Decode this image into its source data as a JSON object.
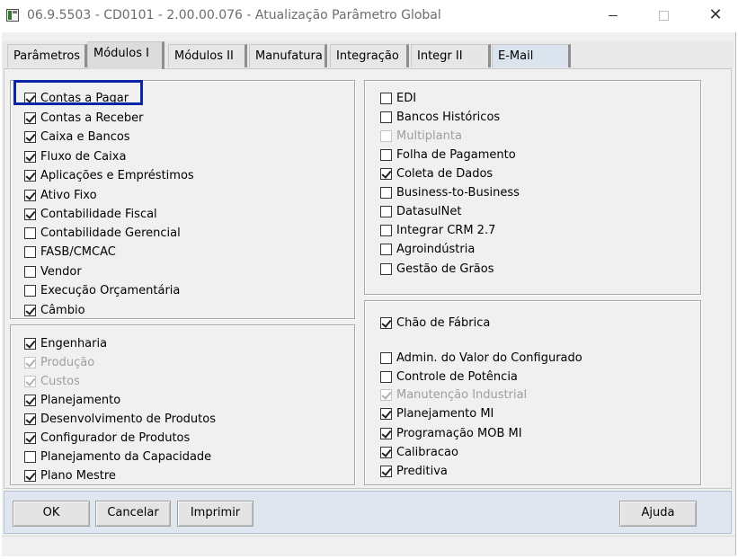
{
  "window": {
    "title": "06.9.5503 - CD0101 - 2.00.00.076 - Atualização Parâmetro Global",
    "close_glyph": "✕"
  },
  "tabs": [
    {
      "label": "Parâmetros"
    },
    {
      "label": "Módulos I",
      "active": true
    },
    {
      "label": "Módulos II"
    },
    {
      "label": "Manufatura"
    },
    {
      "label": "Integração"
    },
    {
      "label": "Integr II"
    },
    {
      "label": "E-Mail"
    }
  ],
  "groups": {
    "financeiro": [
      {
        "label": "Contas a Pagar",
        "checked": true,
        "enabled": true,
        "focused": true
      },
      {
        "label": "Contas a Receber",
        "checked": true,
        "enabled": true
      },
      {
        "label": "Caixa e Bancos",
        "checked": true,
        "enabled": true
      },
      {
        "label": "Fluxo de Caixa",
        "checked": true,
        "enabled": true
      },
      {
        "label": "Aplicações e Empréstimos",
        "checked": true,
        "enabled": true
      },
      {
        "label": "Ativo Fixo",
        "checked": true,
        "enabled": true
      },
      {
        "label": "Contabilidade Fiscal",
        "checked": true,
        "enabled": true
      },
      {
        "label": "Contabilidade Gerencial",
        "checked": false,
        "enabled": true
      },
      {
        "label": "FASB/CMCAC",
        "checked": false,
        "enabled": true
      },
      {
        "label": "Vendor",
        "checked": false,
        "enabled": true
      },
      {
        "label": "Execução Orçamentária",
        "checked": false,
        "enabled": true
      },
      {
        "label": "Câmbio",
        "checked": true,
        "enabled": true
      }
    ],
    "integracao": [
      {
        "label": "EDI",
        "checked": false,
        "enabled": true
      },
      {
        "label": "Bancos Históricos",
        "checked": false,
        "enabled": true
      },
      {
        "label": "Multiplanta",
        "checked": false,
        "enabled": false
      },
      {
        "label": "Folha de Pagamento",
        "checked": false,
        "enabled": true
      },
      {
        "label": "Coleta de Dados",
        "checked": true,
        "enabled": true
      },
      {
        "label": "Business-to-Business",
        "checked": false,
        "enabled": true
      },
      {
        "label": "DatasulNet",
        "checked": false,
        "enabled": true
      },
      {
        "label": "Integrar CRM 2.7",
        "checked": false,
        "enabled": true
      },
      {
        "label": "Agroindústria",
        "checked": false,
        "enabled": true
      },
      {
        "label": "Gestão de Grãos",
        "checked": false,
        "enabled": true
      }
    ],
    "engenharia": [
      {
        "label": "Engenharia",
        "checked": true,
        "enabled": true
      },
      {
        "label": "Produção",
        "checked": true,
        "enabled": false
      },
      {
        "label": "Custos",
        "checked": true,
        "enabled": false
      },
      {
        "label": "Planejamento",
        "checked": true,
        "enabled": true
      },
      {
        "label": "Desenvolvimento de Produtos",
        "checked": true,
        "enabled": true
      },
      {
        "label": "Configurador de Produtos",
        "checked": true,
        "enabled": true
      },
      {
        "label": "Planejamento da Capacidade",
        "checked": false,
        "enabled": true
      },
      {
        "label": "Plano Mestre",
        "checked": true,
        "enabled": true
      }
    ],
    "chao_de_fabrica": [
      {
        "label": "Chão de Fábrica",
        "checked": true,
        "enabled": true
      },
      {
        "label": "Admin. do Valor do Configurado",
        "checked": false,
        "enabled": true
      },
      {
        "label": "Controle de Potência",
        "checked": false,
        "enabled": true
      },
      {
        "label": "Manutenção Industrial",
        "checked": true,
        "enabled": false
      },
      {
        "label": "Planejamento MI",
        "checked": true,
        "enabled": true
      },
      {
        "label": "Programação MOB MI",
        "checked": true,
        "enabled": true
      },
      {
        "label": "Calibracao",
        "checked": true,
        "enabled": true
      },
      {
        "label": "Preditiva",
        "checked": true,
        "enabled": true
      }
    ]
  },
  "buttons": {
    "ok": "OK",
    "cancelar": "Cancelar",
    "imprimir": "Imprimir",
    "ajuda": "Ajuda"
  },
  "colors": {
    "focus_ring": "#0b25a8",
    "button_bar": "#dfe6f0"
  }
}
